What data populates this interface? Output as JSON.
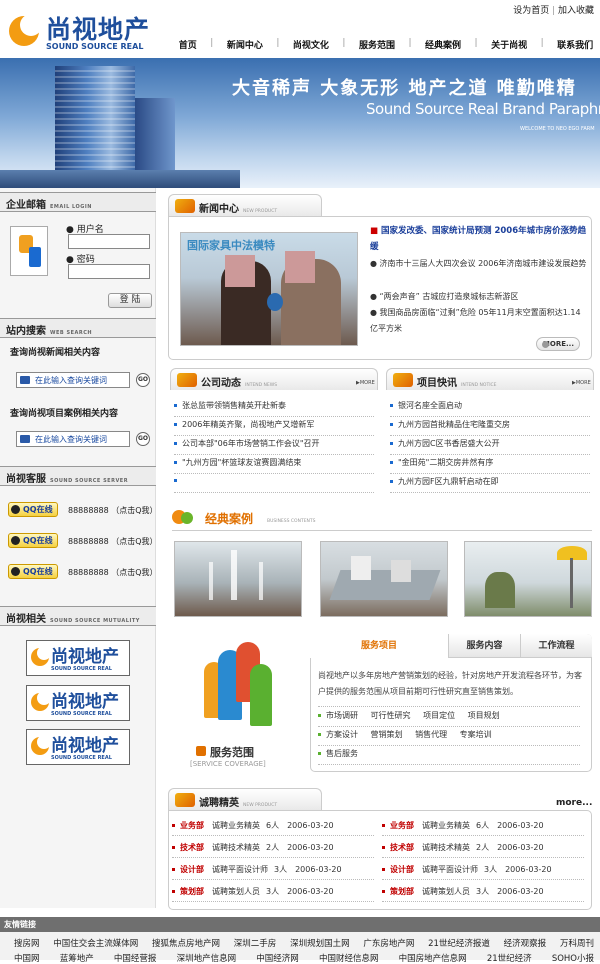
{
  "header": {
    "logo_cn": "尚视地产",
    "logo_en": "SOUND SOURCE REAL",
    "top_links": [
      "设为首页",
      "加入收藏"
    ],
    "nav": [
      "首页",
      "新闻中心",
      "尚视文化",
      "服务范围",
      "经典案例",
      "关于尚视",
      "联系我们"
    ]
  },
  "banner": {
    "slogan_cn": "大音稀声  大象无形  地产之道  唯勤唯精",
    "slogan_en": "Sound Source Real Brand Paraphrase",
    "welcome": "WELCOME TO NEO EGO FARM"
  },
  "left": {
    "mail": {
      "title": "企业邮箱",
      "subtitle": "EMAIL LOGIN",
      "user_label": "用户名",
      "password_label": "密码",
      "login_button": "登 陆"
    },
    "search": {
      "title": "站内搜索",
      "subtitle": "WEB SEARCH",
      "news_label": "查询尚视新闻相关内容",
      "news_placeholder": "在此输入查询关键词",
      "project_label": "查询尚视项目案例相关内容",
      "project_placeholder": "在此输入查询关键词",
      "go": "GO"
    },
    "service": {
      "title": "尚视客服",
      "subtitle": "SOUND SOURCE SERVER",
      "qq_label": "QQ在线",
      "entries": [
        "88888888 （点击Q我）",
        "88888888 （点击Q我）",
        "88888888 （点击Q我）"
      ]
    },
    "related": {
      "title": "尚视相关",
      "subtitle": "SOUND SOURCE MUTUALITY"
    }
  },
  "news_center": {
    "title": "新闻中心",
    "subtitle": "NEW PRODUCT",
    "photo_banner": "国际家具中法模特",
    "headline": "国家发改委、国家统计局预测  2006年城市房价涨势趋缓",
    "items": [
      "济南市十三届人大四次会议  2006年济南城市建设发展趋势",
      "“两会声音”  古城应打造泉城标志新游区",
      "我国商品房面临“过剩”危险  05年11月末空置面积达1.14亿平方米"
    ],
    "more": "MORE..."
  },
  "company_news": {
    "title": "公司动态",
    "subtitle": "INTEND NEWS",
    "more": "MORE",
    "items": [
      "张总监带领销售精英开赴新泰",
      "2006年精英齐聚，尚视地产又增新军",
      "公司本部\"06年市场营销工作会议\"召开",
      "\"九州方园\"杯篮球友谊赛圆满结束",
      ""
    ]
  },
  "project_news": {
    "title": "项目快讯",
    "subtitle": "INTEND NOTICE",
    "more": "MORE",
    "items": [
      "银河名座全面启动",
      "九州方园首批精品住宅隆重交房",
      "九州方园C区书香居盛大公开",
      "\"金田苑\"二期交房井然有序",
      "九州方园F区九鼎轩启动在即"
    ]
  },
  "cases": {
    "title": "经典案例",
    "subtitle": "BUSINESS CONTENTS"
  },
  "services": {
    "tabs": [
      "服务项目",
      "服务内容",
      "工作流程"
    ],
    "label": "服务范围",
    "label_en": "[SERVICE COVERAGE]",
    "description": "尚视地产以多年房地产营销策划的经验，针对房地产开发流程各环节，为客户提供的服务范围从项目前期可行性研究直至销售策划。",
    "items_row1": [
      "市场调研",
      "可行性研究",
      "项目定位",
      "项目规划"
    ],
    "items_row2": [
      "方案设计",
      "营销策划",
      "销售代理",
      "专案培训"
    ],
    "items_row3": [
      "售后服务"
    ]
  },
  "jobs": {
    "title": "诚聘精英",
    "subtitle": "NEW PRODUCT",
    "more": "more...",
    "rows": [
      [
        {
          "dept": "业务部",
          "job": "诚聘业务精英",
          "count": "6人",
          "date": "2006-03-20"
        },
        {
          "dept": "业务部",
          "job": "诚聘业务精英",
          "count": "6人",
          "date": "2006-03-20"
        }
      ],
      [
        {
          "dept": "技术部",
          "job": "诚聘技术精英",
          "count": "2人",
          "date": "2006-03-20"
        },
        {
          "dept": "技术部",
          "job": "诚聘技术精英",
          "count": "2人",
          "date": "2006-03-20"
        }
      ],
      [
        {
          "dept": "设计部",
          "job": "诚聘平面设计师",
          "count": "3人",
          "date": "2006-03-20"
        },
        {
          "dept": "设计部",
          "job": "诚聘平面设计师",
          "count": "3人",
          "date": "2006-03-20"
        }
      ],
      [
        {
          "dept": "策划部",
          "job": "诚聘策划人员",
          "count": "3人",
          "date": "2006-03-20"
        },
        {
          "dept": "策划部",
          "job": "诚聘策划人员",
          "count": "3人",
          "date": "2006-03-20"
        }
      ]
    ]
  },
  "footer": {
    "title": "友情链接",
    "row1": [
      "搜房网",
      "中国住交会主流媒体网",
      "搜狐焦点房地产网",
      "深圳二手房",
      "深圳规划国土网",
      "广东房地产网",
      "21世纪经济报道",
      "经济观察报",
      "万科周刊"
    ],
    "row2": [
      "中国网",
      "蓝筹地产",
      "中国经营报",
      "深圳地产信息网",
      "中国经济网",
      "中国财经信息网",
      "中国房地产信息网",
      "21世纪经济",
      "SOHO小报"
    ]
  },
  "colors": {
    "brand_blue": "#1f4f9c",
    "accent_orange": "#f39c12",
    "link_blue": "#1a3e9a",
    "dept_red": "#c00000"
  }
}
